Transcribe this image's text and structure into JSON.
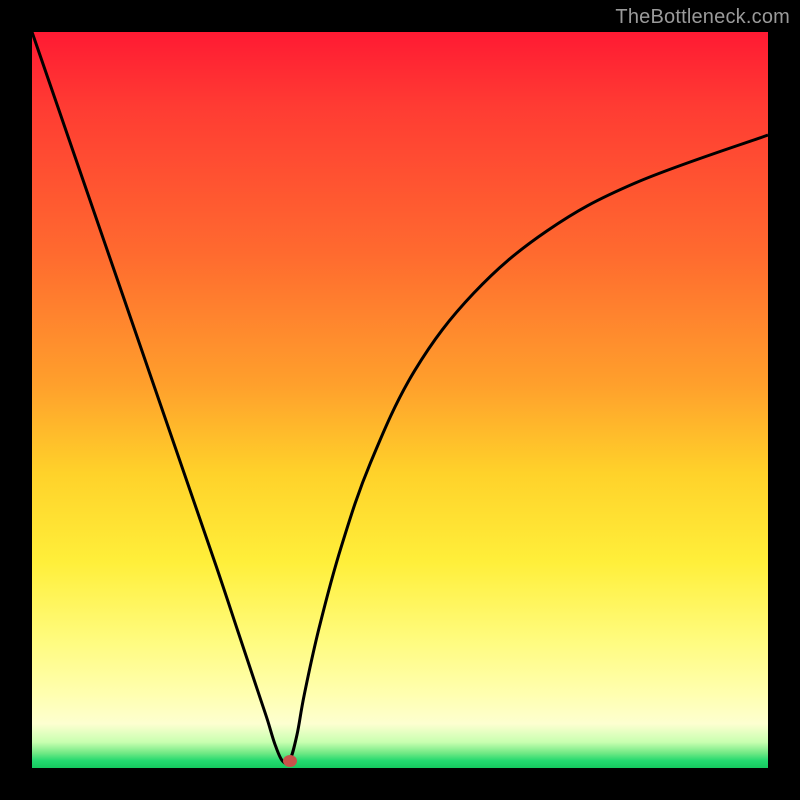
{
  "attribution": "TheBottleneck.com",
  "chart_data": {
    "type": "line",
    "title": "",
    "xlabel": "",
    "ylabel": "",
    "xlim": [
      0,
      100
    ],
    "ylim": [
      0,
      100
    ],
    "grid": false,
    "series": [
      {
        "name": "bottleneck-curve",
        "x": [
          0,
          5,
          10,
          15,
          20,
          25,
          28,
          30,
          31,
          32,
          33,
          34,
          35,
          36,
          37,
          39,
          42,
          46,
          52,
          60,
          70,
          82,
          100
        ],
        "values": [
          100,
          85.5,
          71,
          56.5,
          42,
          27.5,
          18.5,
          12.5,
          9.5,
          6.5,
          3.25,
          1.0,
          1.0,
          4.5,
          10,
          19,
          30,
          41.5,
          54,
          64.5,
          73,
          79.5,
          86
        ]
      }
    ],
    "marker": {
      "x": 35,
      "y": 1.0,
      "color": "#c8534b"
    },
    "colors": {
      "curve": "#000000",
      "gradient_top": "#ff1a33",
      "gradient_bottom": "#15c95f",
      "frame": "#000000"
    }
  }
}
